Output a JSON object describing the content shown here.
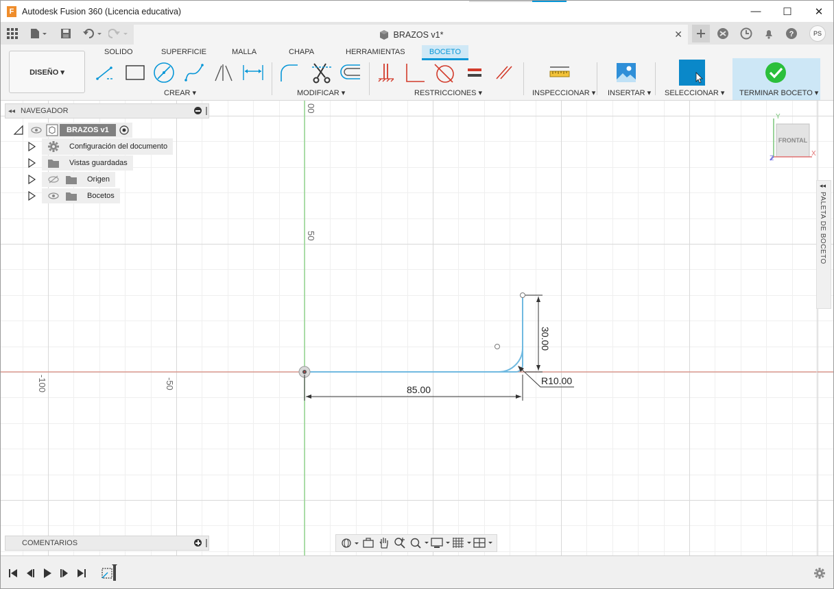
{
  "window": {
    "title": "Autodesk Fusion 360 (Licencia educativa)",
    "logo_letter": "F",
    "minimize": "—",
    "maximize": "☐",
    "close": "✕"
  },
  "document_tab": {
    "title": "BRAZOS v1*",
    "close": "✕",
    "user_initials": "PS"
  },
  "ribbon": {
    "workspace": "DISEÑO ▾",
    "tabs": [
      "SOLIDO",
      "SUPERFICIE",
      "MALLA",
      "CHAPA",
      "HERRAMIENTAS",
      "BOCETO"
    ],
    "active_tab": "BOCETO",
    "groups": {
      "crear": "CREAR ▾",
      "modificar": "MODIFICAR ▾",
      "restricciones": "RESTRICCIONES ▾",
      "inspeccionar": "INSPECCIONAR ▾",
      "insertar": "INSERTAR ▾",
      "seleccionar": "SELECCIONAR ▾",
      "terminar": "TERMINAR BOCETO ▾"
    }
  },
  "navigator": {
    "header": "NAVEGADOR",
    "root": "BRAZOS v1",
    "items": [
      {
        "label": "Configuración del documento",
        "icon": "gear-icon"
      },
      {
        "label": "Vistas guardadas",
        "icon": "folder-icon"
      },
      {
        "label": "Origen",
        "icon": "folder-icon"
      },
      {
        "label": "Bocetos",
        "icon": "folder-icon"
      }
    ]
  },
  "comments": {
    "label": "COMENTARIOS"
  },
  "palette": {
    "label": "PALETA DE BOCETO"
  },
  "viewcube": {
    "face": "FRONTAL",
    "axis_x": "X",
    "axis_y": "Y",
    "axis_z": "Z"
  },
  "sketch": {
    "dim_horizontal": "85.00",
    "dim_vertical": "30.00",
    "dim_radius": "R10.00",
    "axis_label_top": "00",
    "axis_label_50": "50",
    "axis_label_neg50": "-50",
    "axis_label_neg100": "-100"
  },
  "colors": {
    "accent": "#0696d7",
    "sketch_line": "#6fb9e0",
    "x_axis": "#d98b7e",
    "y_axis": "#8fd68a",
    "finish_check": "#2bbf3b"
  }
}
